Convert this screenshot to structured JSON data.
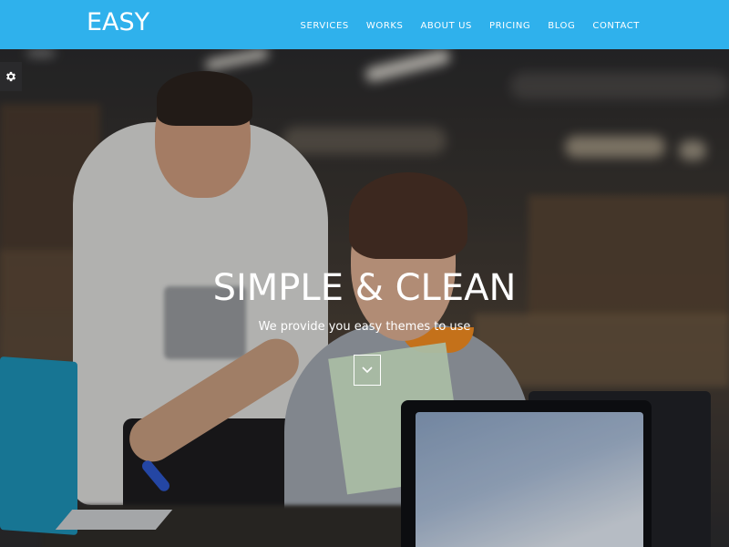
{
  "navbar": {
    "logo": "EASY",
    "items": [
      {
        "label": "SERVICES"
      },
      {
        "label": "WORKS"
      },
      {
        "label": "ABOUT US"
      },
      {
        "label": "PRICING"
      },
      {
        "label": "BLOG"
      },
      {
        "label": "CONTACT"
      }
    ]
  },
  "hero": {
    "title": "SIMPLE & CLEAN",
    "subtitle": "We provide you easy themes to use",
    "scroll_icon": "chevron-down-icon"
  },
  "settings": {
    "icon": "gear-icon"
  },
  "colors": {
    "navbar_bg": "#2fb1ec",
    "text": "#ffffff"
  }
}
